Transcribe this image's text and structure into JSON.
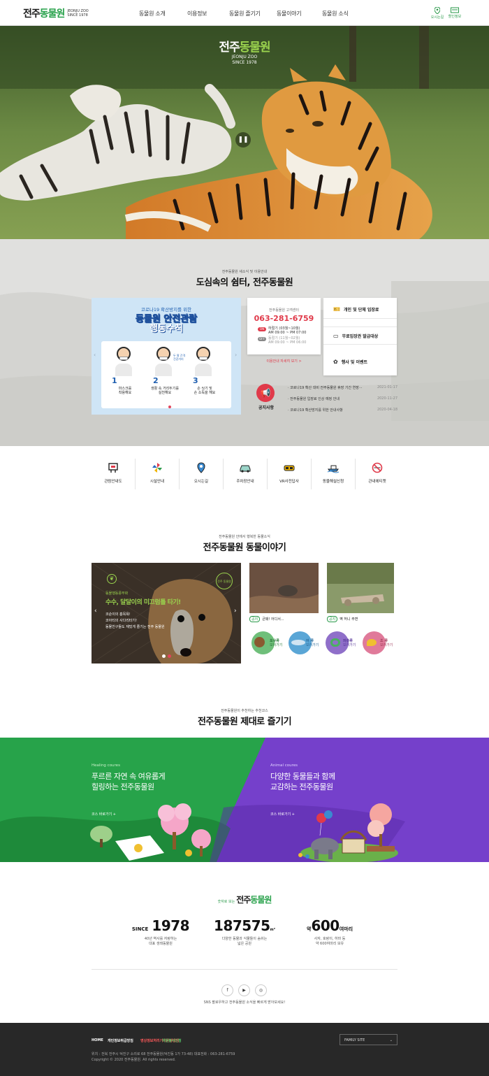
{
  "header": {
    "logo_ko_a": "전주",
    "logo_ko_b": "동물원",
    "logo_en": "JEONJU ZOO",
    "logo_since": "SINCE 1978",
    "nav": [
      "동물원 소개",
      "이용정보",
      "동물원 즐기기",
      "동물이야기",
      "동물원 소식"
    ],
    "icon_directions": "오시는길",
    "icon_discount": "할인정보"
  },
  "hero": {
    "logo_ko_a": "전주",
    "logo_ko_b": "동물원",
    "logo_en": "JEONJU ZOO",
    "logo_since": "SINCE 1978",
    "pause_icon": "pause-icon"
  },
  "info": {
    "subtitle": "전주동물원 새소식 및 이용안내",
    "title": "도심속의 쉼터, 전주동물원",
    "banner": {
      "top": "코로나19 확산방지를 위한",
      "line1": "동물원 안전관람",
      "line2": "행동수칙",
      "steps": [
        {
          "num": "1",
          "label1": "마스크를",
          "label2": "착용해요"
        },
        {
          "num": "2",
          "label1": "생활 속 거리두기를",
          "label2": "실천해요"
        },
        {
          "num": "3",
          "label1": "손 씻기 및",
          "label2": "손 소독을 해요"
        }
      ],
      "bubble": "두 팔 간격 건강거리"
    },
    "center": {
      "label": "전주동물원 고객센터",
      "phone": "063-281-6759",
      "on_badge": "ON",
      "on_season": "하절기 (03월~10월)",
      "on_hours": "AM 09:00 ~ PM 07:00",
      "off_badge": "OFF",
      "off_season": "동절기 (11월~02월)",
      "off_hours": "AM 09:00 ~ PM 06:00",
      "more": "이용안내 자세히 보기 >"
    },
    "quick": [
      {
        "label": "개인 및 단체 입장료",
        "icon": "ticket-icon"
      },
      {
        "label": "무료입장권 발급대상",
        "icon": "card-icon"
      },
      {
        "label": "행사 및 이벤트",
        "icon": "event-icon"
      }
    ],
    "notice": {
      "label": "공지사항",
      "items": [
        {
          "title": "· 코로나19 확산 대비 전주동물원 휴장 기간 연장···",
          "date": "2021-01-17"
        },
        {
          "title": "· 전주동물원 입장료 인상 예정 안내",
          "date": "2020-11-27"
        },
        {
          "title": "· 코로나19 확산방지를 위한 안내사항",
          "date": "2020-04-18"
        }
      ]
    }
  },
  "quickmenu": [
    {
      "label": "관람안내도",
      "icon": "map-board-icon"
    },
    {
      "label": "시설안내",
      "icon": "pinwheel-icon"
    },
    {
      "label": "오시는길",
      "icon": "location-pin-icon"
    },
    {
      "label": "주차장안내",
      "icon": "car-icon"
    },
    {
      "label": "VR사전답사",
      "icon": "vr-glasses-icon"
    },
    {
      "label": "동물해설신청",
      "icon": "boat-icon"
    },
    {
      "label": "관내에티켓",
      "icon": "no-smoking-icon"
    }
  ],
  "story": {
    "subtitle": "전주동물원 안에서 행복한 동물소식",
    "title": "전주동물원 동물이야기",
    "main": {
      "tag": "동물행동풍부화",
      "headline": "수수, 달달이의 미끄럼틀 타기!",
      "text1": "코순이의 흥목욕!",
      "text2": "코아티의 사다리타기!",
      "text3": "동물친구들도 재밌게 즐기는 전주 동물원",
      "badge": "전주 동물원"
    },
    "thumbs": [
      {
        "tag": "공지",
        "caption": "큰돼! 어디서..."
      },
      {
        "tag": "공지",
        "caption": "벽 허니 주변"
      }
    ],
    "categories": [
      {
        "name": "포유류",
        "sub": "보러가기",
        "color": "#6fbf7a",
        "icon": "bear-icon"
      },
      {
        "name": "어 류",
        "sub": "보러가기",
        "color": "#5aa6d6",
        "icon": "fish-icon"
      },
      {
        "name": "파충류",
        "sub": "보러가기",
        "color": "#8f6fc9",
        "icon": "snake-icon"
      },
      {
        "name": "조 류",
        "sub": "보러가기",
        "color": "#e07a9a",
        "icon": "bird-icon"
      }
    ]
  },
  "course": {
    "subtitle": "전주동물원이 추천하는 추천코스",
    "title": "전주동물원 제대로 즐기기",
    "healing": {
      "eyebrow": "Healing coures",
      "line1": "푸르른 자연 속 여유롭게",
      "line2": "힐링하는 전주동물원",
      "more": "코스 바로가기 +"
    },
    "animal": {
      "eyebrow": "Animal coures",
      "line1": "다양한 동물들과 함께",
      "line2": "교감하는 전주동물원",
      "more": "코스 바로가기 +"
    }
  },
  "numbers": {
    "logo_pre": "숫자로 보는",
    "logo_a": "전주",
    "logo_b": "동물원",
    "items": [
      {
        "pre": "SINCE",
        "num": "1978",
        "post": "",
        "d1": "40년 역사를 자랑하는",
        "d2": "대표 생태동물원"
      },
      {
        "pre": "",
        "num": "187575",
        "post": "m²",
        "d1": "다양한 동물과 식물들이 숨쉬는",
        "d2": "넓은 공원"
      },
      {
        "pre": "약",
        "num": "600",
        "post": "여마리",
        "d1": "사자, 호랑이, 하마 등",
        "d2": "약 600여마리 보유"
      }
    ],
    "sns_caption": "SNS 팔로우하고 전주동물원 소식을 빠르게 받아보세요!",
    "sns": [
      "f",
      "▶",
      "◎"
    ]
  },
  "footer": {
    "links": [
      "HOME",
      "개인정보취급방침",
      "영상정보처리기기운영방침",
      "자원봉사신청"
    ],
    "link_colors": [
      "#ffffff",
      "#ffffff",
      "#ff5a5a",
      "#5ad06a"
    ],
    "family": "FAMILY SITE",
    "address": "위치 : 전북 전주시 덕진구 소리로 68 전주동물원(덕진동 1가 73-48)    대표전화 : 063-281-6759",
    "copyright": "Copyright © 2020 전주동물원. All rights reserved."
  }
}
